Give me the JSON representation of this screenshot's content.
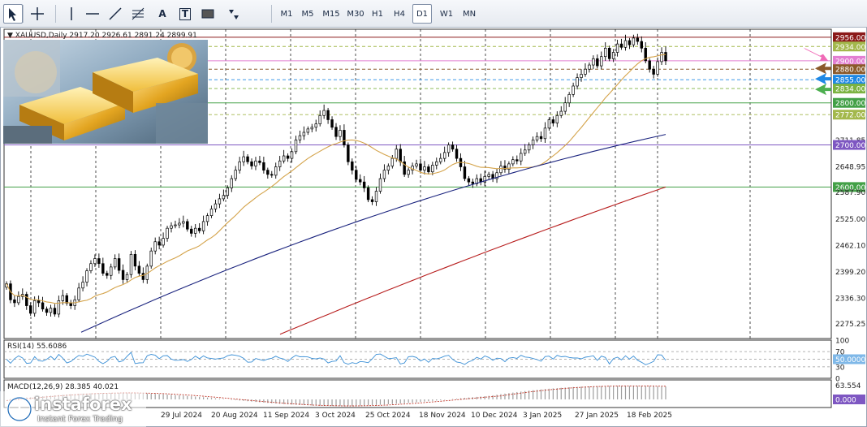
{
  "toolbar": {
    "tools": [
      "cursor-icon",
      "crosshair-icon",
      "vertical-line-icon",
      "horizontal-line-icon",
      "trendline-icon",
      "fibonacci-icon",
      "text-icon",
      "label-icon",
      "rectangle-icon",
      "arrows-icon"
    ],
    "text_tool": "A",
    "label_tool": "T",
    "timeframes": [
      "M1",
      "M5",
      "M15",
      "M30",
      "H1",
      "H4",
      "D1",
      "W1",
      "MN"
    ],
    "active_timeframe": "D1"
  },
  "header": {
    "symbol": "XAUUSD,Daily",
    "ohlc": "2917.20 2926.61 2891.24 2899.91"
  },
  "indicators": {
    "rsi_label": "RSI(14) 55.6086",
    "macd_label": "MACD(12,26,9) 28.385 40.021"
  },
  "brand": {
    "name": "instaforex",
    "tagline": "Instant Forex Trading",
    "logo_color": "#1e6bb8"
  },
  "colors": {
    "up_candle": "#ffffff",
    "down_candle": "#000000",
    "ma_fast": "#d4a34a",
    "ma_mid": "#1a237e",
    "ma_slow": "#b71c1c",
    "rsi_line": "#3a8fd6",
    "macd_hist": "#9c9c9c",
    "macd_signal": "#c0392b"
  },
  "chart_data": {
    "type": "candlestick",
    "title": "XAUUSD,Daily",
    "ylim": [
      2240,
      2975
    ],
    "price_axis_ticks": [
      "2956.00",
      "2934.00",
      "2900.00",
      "2880.00",
      "2855.00",
      "2834.00",
      "2800.00",
      "2772.00",
      "2711.85",
      "2700.00",
      "2648.95",
      "2600.00",
      "2587.90",
      "2525.00",
      "2462.10",
      "2399.20",
      "2336.30",
      "2275.25"
    ],
    "date_labels": [
      "29 Jul 2024",
      "20 Aug 2024",
      "11 Sep 2024",
      "3 Oct 2024",
      "25 Oct 2024",
      "18 Nov 2024",
      "10 Dec 2024",
      "3 Jan 2025",
      "27 Jan 2025",
      "18 Feb 2025"
    ],
    "horizontal_levels": [
      {
        "price": 2956,
        "label": "2956.00",
        "color": "#8b1a1a",
        "style": "solid",
        "tag_bg": "#8b1a1a"
      },
      {
        "price": 2934,
        "label": "2934.00",
        "color": "#a3b84c",
        "style": "dashed",
        "tag_bg": "#a3b84c"
      },
      {
        "price": 2900,
        "label": "2900.00",
        "color": "#e27fd2",
        "style": "solid",
        "tag_bg": "#e27fd2"
      },
      {
        "price": 2880,
        "label": "2880.00",
        "color": "#8b5a2b",
        "style": "dashed",
        "tag_bg": "#8b5a2b"
      },
      {
        "price": 2855,
        "label": "2855.00",
        "color": "#1e88e5",
        "style": "dashed",
        "tag_bg": "#1e88e5"
      },
      {
        "price": 2834,
        "label": "2834.00",
        "color": "#7cb342",
        "style": "dashed",
        "tag_bg": "#7cb342"
      },
      {
        "price": 2800,
        "label": "2800.00",
        "color": "#43a047",
        "style": "solid",
        "tag_bg": "#43a047"
      },
      {
        "price": 2772,
        "label": "2772.00",
        "color": "#a3b84c",
        "style": "dashed",
        "tag_bg": "#a3b84c"
      },
      {
        "price": 2700,
        "label": "2700.00",
        "color": "#7e57c2",
        "style": "solid",
        "tag_bg": "#7e57c2"
      },
      {
        "price": 2600,
        "label": "2600.00",
        "color": "#43a047",
        "style": "solid",
        "tag_bg": "#43a047"
      }
    ],
    "close_series": [
      2370,
      2332,
      2325,
      2340,
      2345,
      2318,
      2300,
      2330,
      2325,
      2310,
      2302,
      2312,
      2298,
      2330,
      2342,
      2324,
      2318,
      2332,
      2360,
      2374,
      2401,
      2418,
      2430,
      2418,
      2395,
      2390,
      2410,
      2430,
      2402,
      2380,
      2392,
      2440,
      2412,
      2395,
      2380,
      2412,
      2448,
      2470,
      2462,
      2478,
      2502,
      2508,
      2510,
      2514,
      2518,
      2500,
      2490,
      2502,
      2496,
      2518,
      2532,
      2548,
      2560,
      2572,
      2580,
      2598,
      2620,
      2640,
      2660,
      2672,
      2660,
      2650,
      2662,
      2658,
      2640,
      2630,
      2628,
      2648,
      2662,
      2674,
      2668,
      2684,
      2712,
      2722,
      2730,
      2738,
      2742,
      2750,
      2770,
      2782,
      2760,
      2742,
      2720,
      2735,
      2700,
      2660,
      2640,
      2618,
      2612,
      2598,
      2570,
      2565,
      2590,
      2620,
      2640,
      2650,
      2668,
      2690,
      2660,
      2630,
      2640,
      2650,
      2655,
      2640,
      2648,
      2636,
      2652,
      2660,
      2668,
      2682,
      2700,
      2690,
      2668,
      2648,
      2620,
      2612,
      2608,
      2620,
      2612,
      2625,
      2630,
      2620,
      2634,
      2650,
      2642,
      2655,
      2665,
      2662,
      2680,
      2688,
      2700,
      2712,
      2720,
      2715,
      2740,
      2760,
      2752,
      2770,
      2780,
      2800,
      2820,
      2840,
      2860,
      2868,
      2880,
      2890,
      2905,
      2888,
      2910,
      2930,
      2905,
      2920,
      2940,
      2932,
      2948,
      2938,
      2954,
      2946,
      2930,
      2900,
      2880,
      2868,
      2898,
      2920,
      2900
    ],
    "ma_fast_start": 2320,
    "rsi": {
      "value": 55.6086,
      "levels": [
        100,
        70,
        50,
        30,
        0
      ],
      "level_labels": [
        "100",
        "70",
        "50.0000",
        "30",
        "0"
      ]
    },
    "macd": {
      "main": 28.385,
      "signal": 40.021,
      "axis_labels": [
        "63.554",
        "0.000"
      ]
    }
  }
}
